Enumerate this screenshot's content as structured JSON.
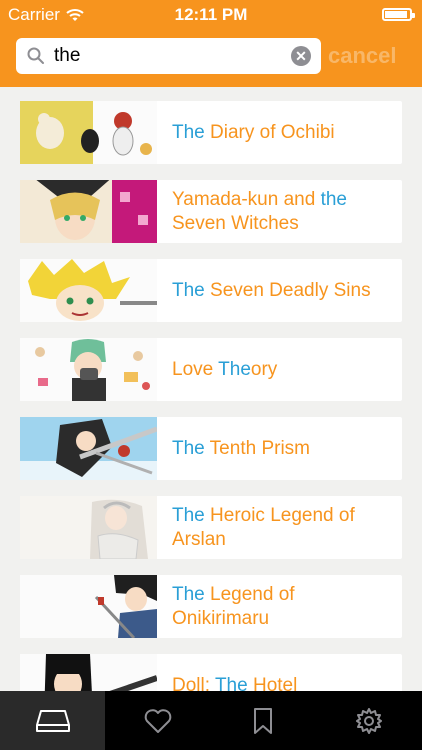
{
  "status_bar": {
    "carrier": "Carrier",
    "time": "12:11 PM"
  },
  "search": {
    "value": "the",
    "placeholder": "",
    "cancel_label": "cancel",
    "clear_icon": "clear-icon"
  },
  "results": [
    {
      "prefix": "",
      "highlight": "The",
      "suffix": " Diary of Ochibi",
      "line2": ""
    },
    {
      "prefix": "Yamada-kun and ",
      "highlight": "the",
      "suffix": "",
      "line2": "Seven Witches"
    },
    {
      "prefix": "",
      "highlight": "The",
      "suffix": " Seven Deadly Sins",
      "line2": ""
    },
    {
      "prefix": "Love ",
      "highlight": "The",
      "suffix": "ory",
      "line2": ""
    },
    {
      "prefix": "",
      "highlight": "The",
      "suffix": " Tenth Prism",
      "line2": ""
    },
    {
      "prefix": "",
      "highlight": "The",
      "suffix": " Heroic Legend of",
      "line2": "Arslan"
    },
    {
      "prefix": "",
      "highlight": "The",
      "suffix": " Legend of",
      "line2": "Onikirimaru"
    },
    {
      "prefix": "Doll: ",
      "highlight": "The",
      "suffix": " Hotel",
      "line2": ""
    }
  ],
  "tabs": [
    {
      "icon": "library-icon",
      "active": true
    },
    {
      "icon": "heart-icon",
      "active": false
    },
    {
      "icon": "bookmark-icon",
      "active": false
    },
    {
      "icon": "gear-icon",
      "active": false
    }
  ],
  "colors": {
    "accent": "#f7941e",
    "highlight": "#2a9fd6",
    "tabbar": "#000000"
  }
}
